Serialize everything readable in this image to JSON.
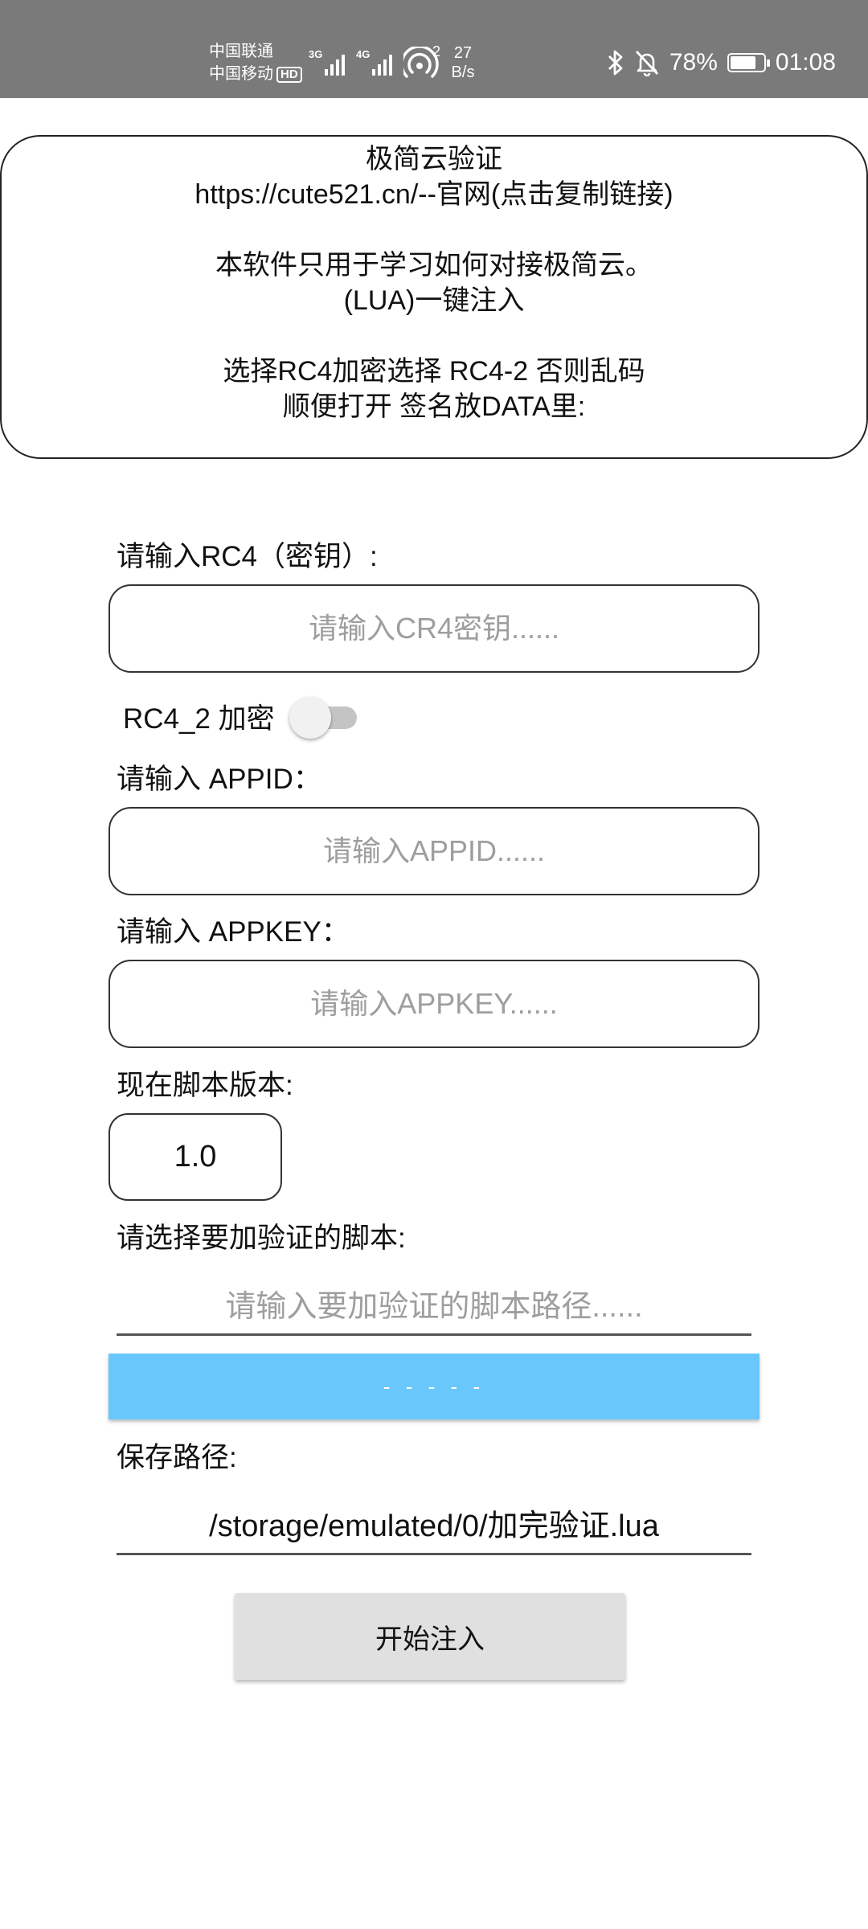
{
  "status_bar": {
    "carrier_1": "中国联通",
    "carrier_2": "中国移动",
    "hd_badge": "HD",
    "net_1": "3G",
    "net_2": "4G",
    "hotspot_count": "2",
    "speed_value": "27",
    "speed_unit": "B/s",
    "battery_percent": "78%",
    "battery_level": 0.78,
    "time": "01:08",
    "icons": [
      "bluetooth-icon",
      "mute-bell-icon",
      "battery-icon",
      "hotspot-icon"
    ]
  },
  "info_card": {
    "title": "极简云验证",
    "url_line": "https://cute521.cn/--官网(点击复制链接)",
    "desc_line_1": "本软件只用于学习如何对接极简云。",
    "desc_line_2": "(LUA)一键注入",
    "note_line_1": "选择RC4加密选择 RC4-2 否则乱码",
    "note_line_2": "顺便打开 签名放DATA里:"
  },
  "form": {
    "rc4_label": "请输入RC4（密钥）:",
    "rc4_placeholder": "请输入CR4密钥......",
    "rc4_2_label": "RC4_2 加密",
    "rc4_2_enabled": false,
    "appid_label": "请输入 APPID：",
    "appid_placeholder": "请输入APPID......",
    "appkey_label": "请输入 APPKEY：",
    "appkey_placeholder": "请输入APPKEY......",
    "version_label": "现在脚本版本:",
    "version_value": "1.0",
    "script_label": "请选择要加验证的脚本:",
    "script_placeholder": "请输入要加验证的脚本路径......",
    "browse_label": "- - - - -",
    "save_label": "保存路径:",
    "save_path": "/storage/emulated/0/加完验证.lua",
    "start_button": "开始注入"
  },
  "colors": {
    "status_bar_bg": "#7a7a7a",
    "browse_button_bg": "#69c7fb",
    "start_button_bg": "#e0e0e0"
  }
}
